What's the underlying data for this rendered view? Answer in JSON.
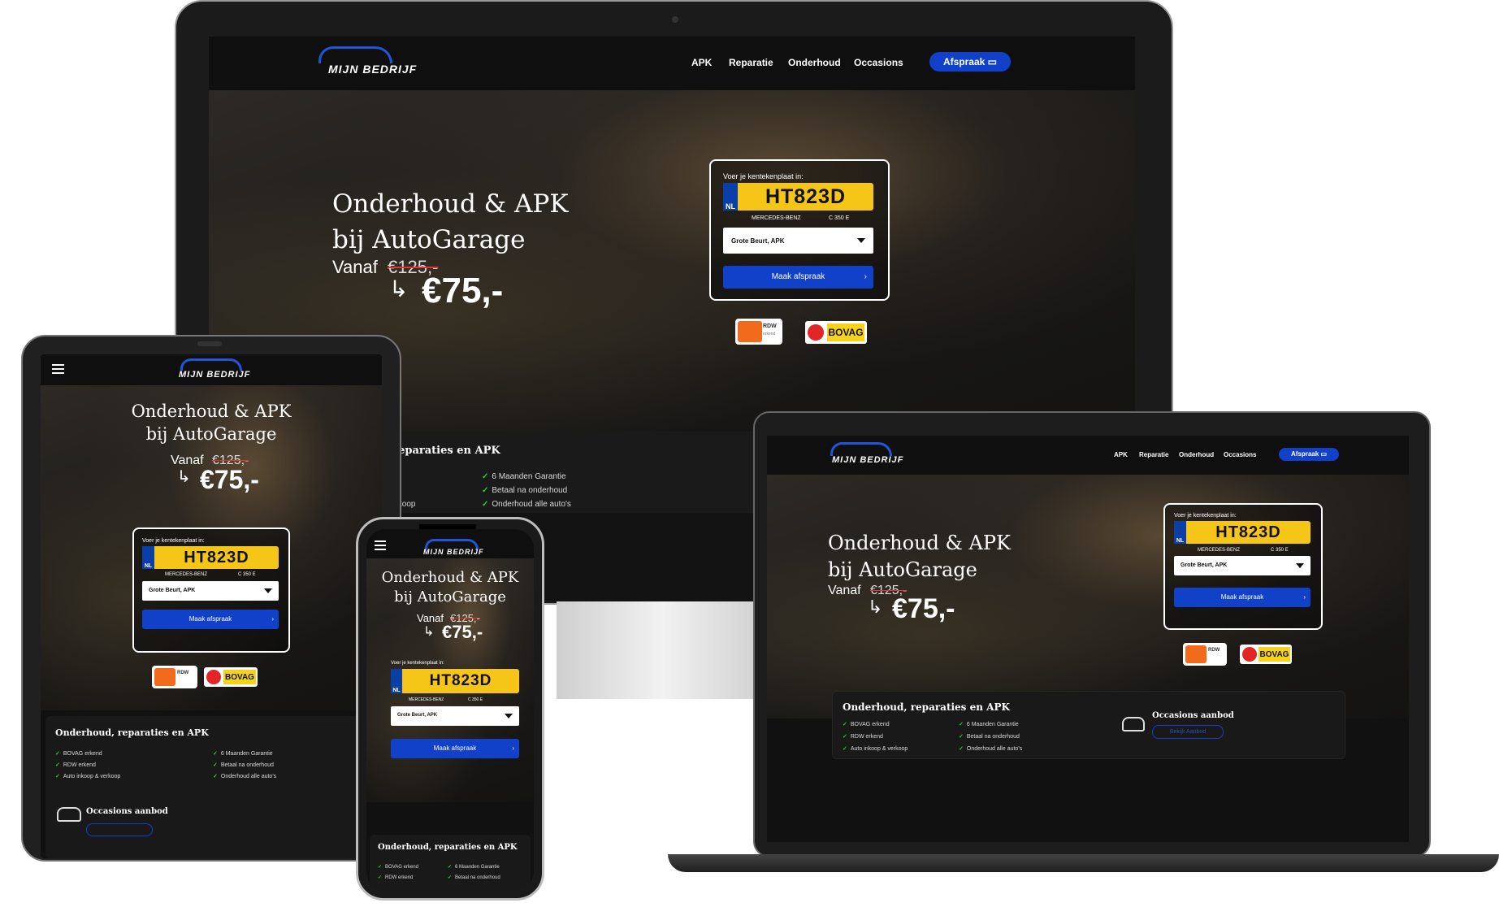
{
  "brand": {
    "name": "MIJN BEDRIJF"
  },
  "nav": {
    "items": [
      "APK",
      "Reparatie",
      "Onderhoud",
      "Occasions"
    ],
    "cta": "Afspraak"
  },
  "hero": {
    "title_line1": "Onderhoud & APK",
    "title_line2": "bij AutoGarage",
    "price_prefix": "Vanaf",
    "old_price": "€125,-",
    "new_price": "€75,-"
  },
  "form": {
    "label": "Voer je kentekenplaat in:",
    "country": "NL",
    "plate": "HT823D",
    "make": "MERCEDES-BENZ",
    "model": "C 350 E",
    "service_selected": "Grote Beurt, APK",
    "submit": "Maak afspraak"
  },
  "badges": {
    "rdw": "RDW",
    "rdw_sub": "erkend",
    "bovag": "BOVAG"
  },
  "usp": {
    "title": "Onderhoud, reparaties en APK",
    "col1": [
      "BOVAG erkend",
      "RDW erkend",
      "Auto inkoop & verkoop"
    ],
    "col2": [
      "6 Maanden Garantie",
      "Betaal na onderhoud",
      "Onderhoud alle auto's"
    ],
    "desktop_title_partial": "oud, reparaties en APK",
    "desktop_col1_partial": [
      "rkend",
      "end",
      "oop & verkoop"
    ]
  },
  "occasions": {
    "title": "Occasions aanbod",
    "button": "Bekijk Aanbod",
    "button_partial": "Bekijk Aanbod"
  },
  "colors": {
    "accent": "#1140c9",
    "plate": "#f5c518",
    "check": "#35c93d",
    "strike": "#e53232"
  }
}
